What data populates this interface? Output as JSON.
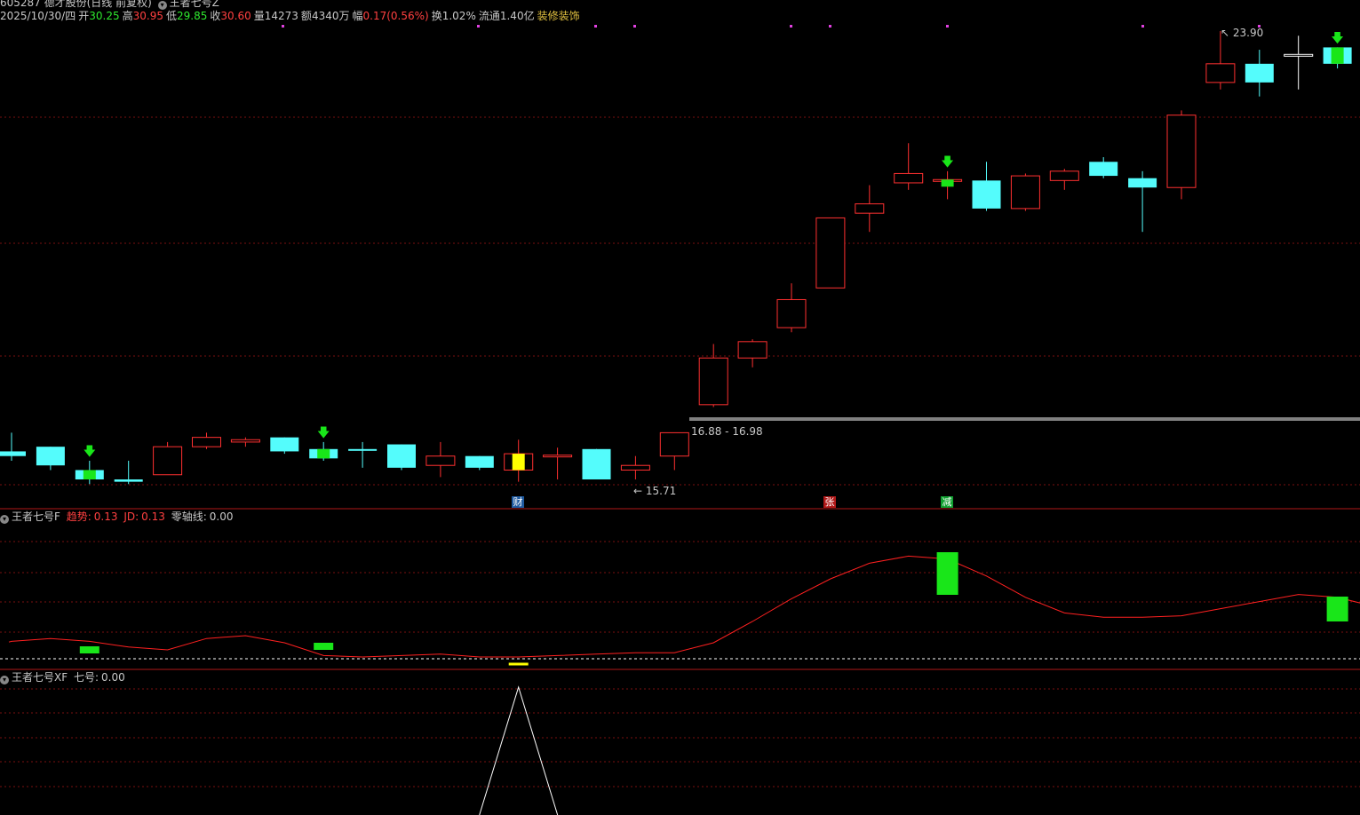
{
  "header": {
    "code_name": "605287 德才股份(日线 前复权)",
    "indicator": "王者七号Z",
    "date": "2025/10/30/四",
    "open_label": "开",
    "open": "30.25",
    "high_label": "高",
    "high": "30.95",
    "low_label": "低",
    "low": "29.85",
    "close_label": "收",
    "close": "30.60",
    "vol_label": "量",
    "vol": "14273",
    "amt_label": "额",
    "amt": "4340万",
    "chg_label": "幅",
    "chg": "0.17(0.56%)",
    "turn_label": "换",
    "turn": "1.02%",
    "float_label": "流通",
    "float": "1.40亿",
    "sector": "装修装饰"
  },
  "main_chart": {
    "max_label": "23.90",
    "min_label": "15.71",
    "range_label": "16.88 - 16.98",
    "markers": [
      "财",
      "张",
      "减"
    ]
  },
  "panel_f": {
    "name": "王者七号F",
    "trend_label": "趋势:",
    "trend_value": "0.13",
    "jd_label": "JD:",
    "jd_value": "0.13",
    "zero_label": "零轴线:",
    "zero_value": "0.00"
  },
  "panel_xf": {
    "name": "王者七号XF",
    "seven_label": "七号:",
    "seven_value": "0.00"
  },
  "colors": {
    "up": "#ff3030",
    "down": "#54fcfc",
    "signal": "#19e619",
    "yellow": "#ffff00",
    "grid": "#7a1010"
  },
  "chart_data": {
    "type": "candlestick",
    "candles": [
      {
        "o": 14.9,
        "c": 14.8,
        "h": 15.3,
        "l": 14.7
      },
      {
        "o": 15.0,
        "c": 14.6,
        "h": 15.0,
        "l": 14.5
      },
      {
        "o": 14.5,
        "c": 14.3,
        "h": 14.7,
        "l": 14.2,
        "sig": 1
      },
      {
        "o": 14.3,
        "c": 14.25,
        "h": 14.7,
        "l": 14.2
      },
      {
        "o": 14.4,
        "c": 15.0,
        "h": 15.1,
        "l": 14.4
      },
      {
        "o": 15.0,
        "c": 15.2,
        "h": 15.3,
        "l": 14.95
      },
      {
        "o": 15.1,
        "c": 15.15,
        "h": 15.2,
        "l": 15.0
      },
      {
        "o": 15.2,
        "c": 14.9,
        "h": 15.2,
        "l": 14.85
      },
      {
        "o": 14.95,
        "c": 14.75,
        "h": 15.1,
        "l": 14.7,
        "sig": 1
      },
      {
        "o": 14.95,
        "c": 14.92,
        "h": 15.1,
        "l": 14.55
      },
      {
        "o": 15.05,
        "c": 14.55,
        "h": 15.05,
        "l": 14.5
      },
      {
        "o": 14.6,
        "c": 14.8,
        "h": 15.1,
        "l": 14.35
      },
      {
        "o": 14.8,
        "c": 14.55,
        "h": 14.8,
        "l": 14.5
      },
      {
        "o": 14.5,
        "c": 14.85,
        "h": 15.15,
        "l": 14.25,
        "sig": 2
      },
      {
        "o": 14.8,
        "c": 14.82,
        "h": 14.98,
        "l": 14.3
      },
      {
        "o": 14.95,
        "c": 14.3,
        "h": 14.95,
        "l": 14.3
      },
      {
        "o": 14.5,
        "c": 14.6,
        "h": 14.8,
        "l": 14.3
      },
      {
        "o": 14.8,
        "c": 15.3,
        "h": 15.3,
        "l": 14.5
      },
      {
        "o": 15.9,
        "c": 16.9,
        "h": 17.2,
        "l": 15.85
      },
      {
        "o": 16.9,
        "c": 17.25,
        "h": 17.3,
        "l": 16.7
      },
      {
        "o": 17.55,
        "c": 18.15,
        "h": 18.5,
        "l": 17.45
      },
      {
        "o": 18.4,
        "c": 19.9,
        "h": 19.9,
        "l": 18.4
      },
      {
        "o": 20.0,
        "c": 20.2,
        "h": 20.6,
        "l": 19.6
      },
      {
        "o": 20.65,
        "c": 20.85,
        "h": 21.5,
        "l": 20.5
      },
      {
        "o": 20.7,
        "c": 20.72,
        "h": 20.9,
        "l": 20.3,
        "sig": 1
      },
      {
        "o": 20.7,
        "c": 20.1,
        "h": 21.1,
        "l": 20.05
      },
      {
        "o": 20.1,
        "c": 20.8,
        "h": 20.85,
        "l": 20.05
      },
      {
        "o": 20.7,
        "c": 20.9,
        "h": 20.95,
        "l": 20.5
      },
      {
        "o": 21.1,
        "c": 20.8,
        "h": 21.2,
        "l": 20.75
      },
      {
        "o": 20.75,
        "c": 20.55,
        "h": 20.9,
        "l": 19.6
      },
      {
        "o": 20.55,
        "c": 22.1,
        "h": 22.2,
        "l": 20.3
      },
      {
        "o": 22.8,
        "c": 23.2,
        "h": 23.9,
        "l": 22.65
      },
      {
        "o": 23.2,
        "c": 22.8,
        "h": 23.5,
        "l": 22.5
      },
      {
        "o": 23.4,
        "c": 23.4,
        "h": 23.8,
        "l": 22.65
      },
      {
        "o": 23.55,
        "c": 23.2,
        "h": 23.55,
        "l": 23.1,
        "sig": 1
      }
    ],
    "trend_line": [
      0.6,
      0.8,
      0.6,
      0.2,
      0.0,
      0.8,
      1.0,
      0.5,
      -0.4,
      -0.5,
      -0.4,
      -0.3,
      -0.5,
      -0.5,
      -0.4,
      -0.3,
      -0.2,
      -0.2,
      0.5,
      2.0,
      3.6,
      5.0,
      6.1,
      6.6,
      6.4,
      5.2,
      3.7,
      2.6,
      2.3,
      2.3,
      2.4,
      2.9,
      3.4,
      3.9,
      3.7
    ],
    "xf_spike_index": 13,
    "xf_spike_value": 1
  }
}
